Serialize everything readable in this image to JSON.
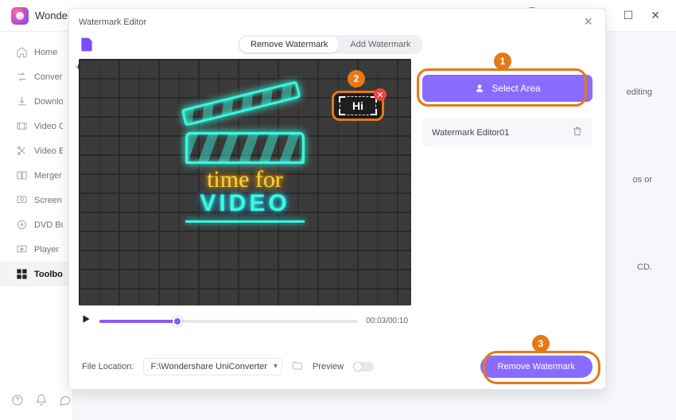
{
  "app": {
    "title": "Wondershare UniConverter"
  },
  "sidebar": {
    "items": [
      {
        "label": "Home"
      },
      {
        "label": "Converter"
      },
      {
        "label": "Downloader"
      },
      {
        "label": "Video Compressor"
      },
      {
        "label": "Video Editor"
      },
      {
        "label": "Merger"
      },
      {
        "label": "Screen Recorder"
      },
      {
        "label": "DVD Burner"
      },
      {
        "label": "Player"
      },
      {
        "label": "Toolbox"
      }
    ]
  },
  "bg": {
    "t1": "editing",
    "t2": "os or",
    "t3": "CD."
  },
  "modal": {
    "title": "Watermark Editor",
    "tab_remove": "Remove Watermark",
    "tab_add": "Add Watermark",
    "select_area": "Select Area",
    "item_name": "Watermark Editor01",
    "selection_text": "Hi",
    "time": "00:03/00:10",
    "progress_pct": 30,
    "file_location_label": "File Location:",
    "file_location_value": "F:\\Wondershare UniConverter",
    "preview_label": "Preview",
    "remove_button": "Remove Watermark",
    "neon_line1": "time for",
    "neon_line2": "VIDEO"
  },
  "callouts": {
    "b1": "1",
    "b2": "2",
    "b3": "3"
  }
}
